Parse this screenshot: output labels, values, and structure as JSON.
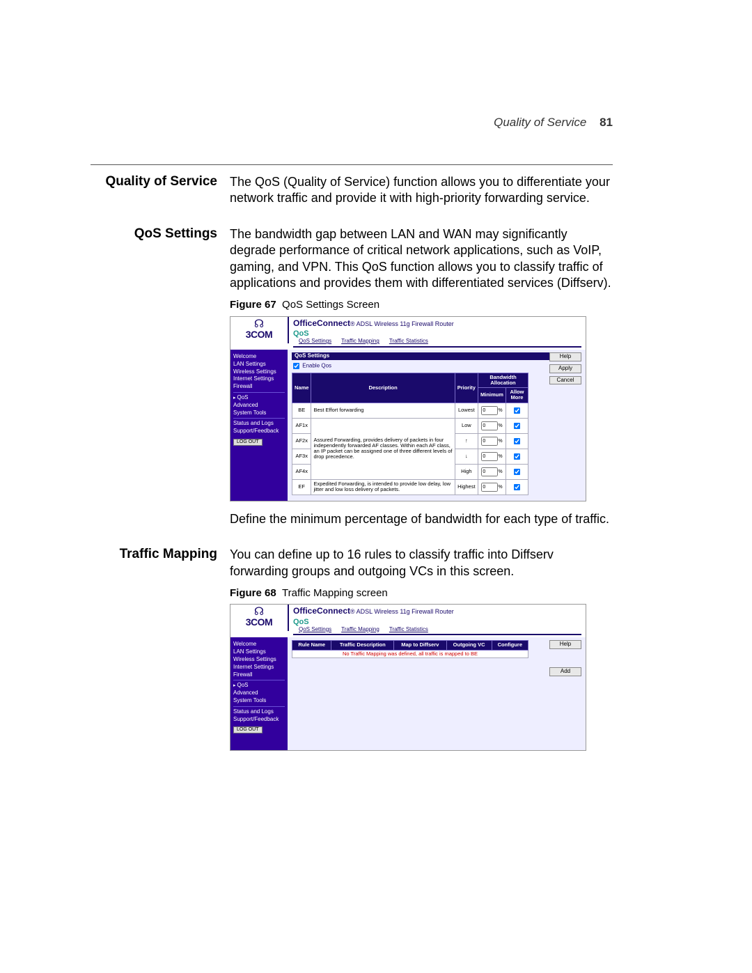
{
  "header": {
    "running_title": "Quality of Service",
    "page_number": "81"
  },
  "sections": {
    "qos_main": {
      "side": "Quality of Service",
      "text": "The QoS (Quality of Service) function allows you to differentiate your network traffic and provide it with high-priority forwarding service."
    },
    "qos_settings": {
      "side": "QoS Settings",
      "text": "The bandwidth gap between LAN and WAN may significantly degrade performance of critical network applications, such as VoIP, gaming, and VPN. This QoS function allows you to classify traffic of applications and provides them with differentiated services (Diffserv).",
      "fig_label": "Figure 67",
      "fig_caption": "QoS Settings Screen",
      "after_text": "Define the minimum percentage of bandwidth for each type of traffic."
    },
    "traffic_mapping": {
      "side": "Traffic Mapping",
      "text": "You can define up to 16 rules to classify traffic into Diffserv forwarding groups and outgoing VCs in this screen.",
      "fig_label": "Figure 68",
      "fig_caption": "Traffic Mapping screen"
    }
  },
  "screenshot_common": {
    "brand": "3COM",
    "product": "OfficeConnect",
    "product_sub": "ADSL Wireless 11g Firewall Router",
    "section": "QoS",
    "tabs": [
      "QoS Settings",
      "Traffic Mapping",
      "Traffic Statistics"
    ],
    "nav": [
      "Welcome",
      "LAN Settings",
      "Wireless Settings",
      "Internet Settings",
      "Firewall",
      "QoS",
      "Advanced",
      "System Tools",
      "Status and Logs",
      "Support/Feedback"
    ],
    "logout": "LOG OUT"
  },
  "shot1": {
    "panel_title": "QoS Settings",
    "enable_label": "Enable Qos",
    "buttons": [
      "Help",
      "Apply",
      "Cancel"
    ],
    "cols": {
      "name": "Name",
      "desc": "Description",
      "prio": "Priority",
      "bw": "Bandwidth Allocation",
      "min": "Minimum",
      "more": "Allow More"
    },
    "rows": [
      {
        "name": "BE",
        "desc": "Best Effort forwarding",
        "prio": "Lowest",
        "min": "0"
      },
      {
        "name": "AF1x",
        "desc": "Assured Forwarding, provides delivery of packets in four independently forwarded AF classes. Within each AF class, an IP packet can be assigned one of three different levels of drop precedence.",
        "prio": "Low",
        "min": "0"
      },
      {
        "name": "AF2x",
        "desc": "",
        "prio": "↑",
        "min": "0"
      },
      {
        "name": "AF3x",
        "desc": "",
        "prio": "↓",
        "min": "0"
      },
      {
        "name": "AF4x",
        "desc": "",
        "prio": "High",
        "min": "0"
      },
      {
        "name": "EF",
        "desc": "Expedited Forwarding, is intended to provide low delay, low jitter and low loss delivery of packets.",
        "prio": "Highest",
        "min": "0"
      }
    ]
  },
  "shot2": {
    "cols": [
      "Rule Name",
      "Traffic Description",
      "Map to Diffserv",
      "Outgoing VC",
      "Configure"
    ],
    "empty": "No Traffic Mapping was defined, all traffic is mapped to BE",
    "buttons": [
      "Help",
      "Add"
    ]
  }
}
